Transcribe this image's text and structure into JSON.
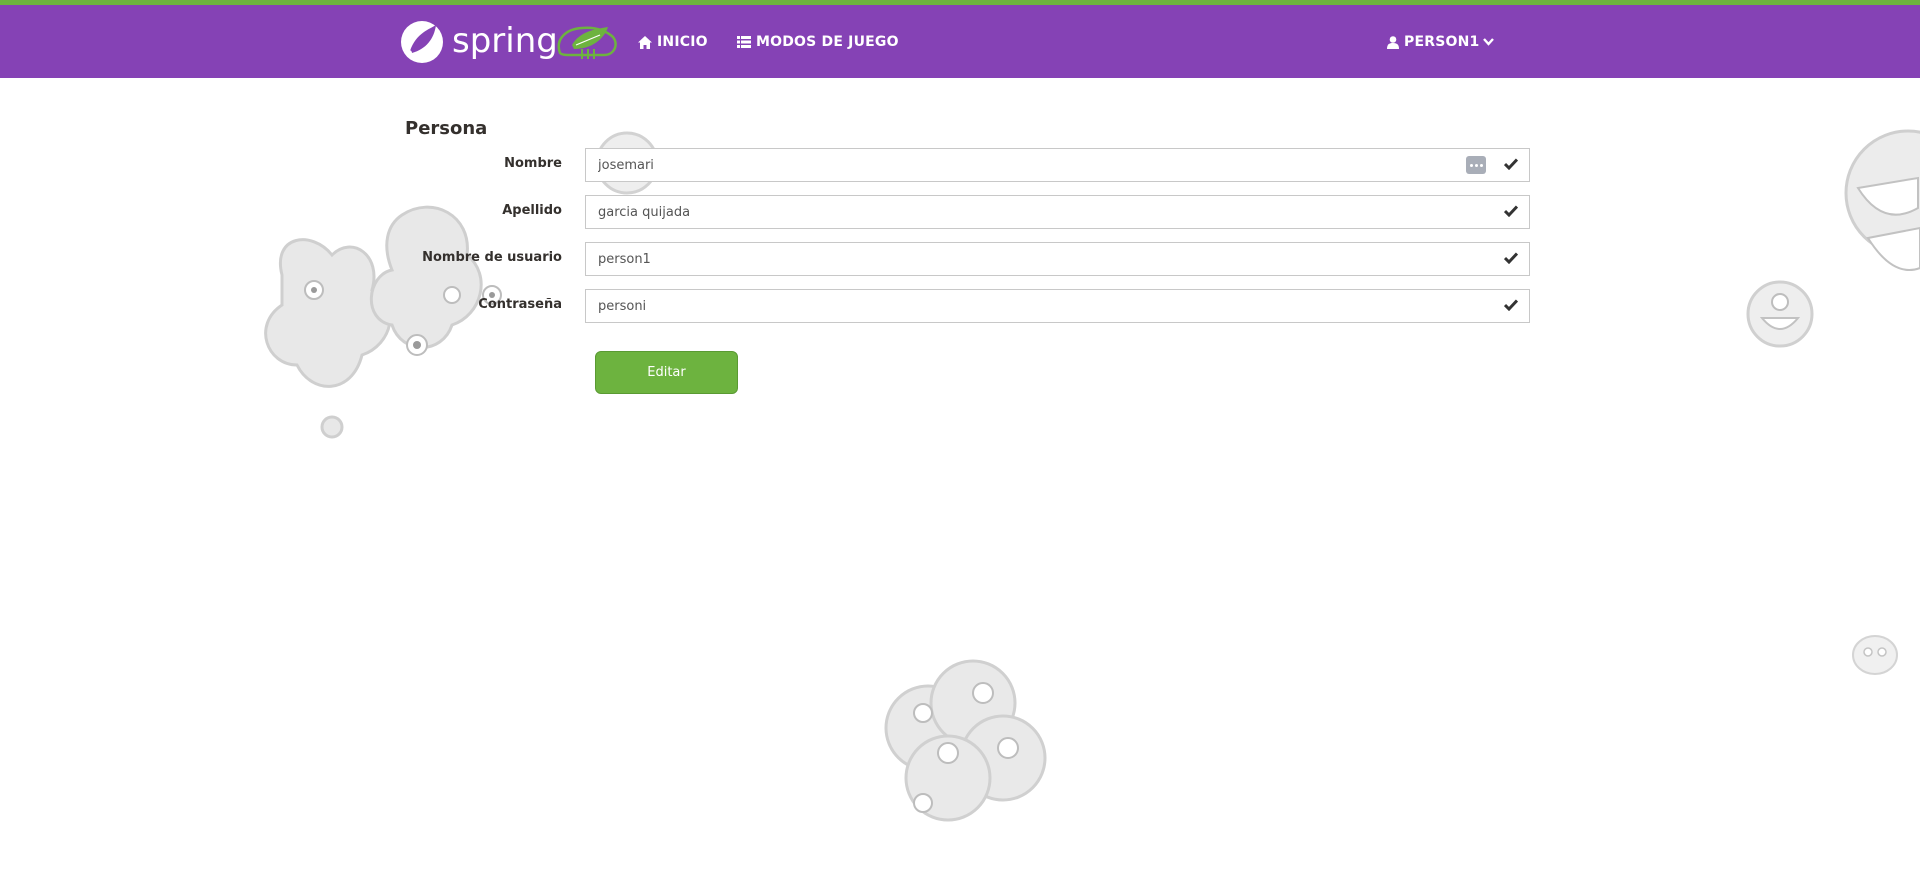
{
  "brand": {
    "logo_text": "spring"
  },
  "nav": {
    "inicio": "Inicio",
    "modos": "Modos de juego",
    "user": "person1"
  },
  "form": {
    "title": "Persona",
    "fields": [
      {
        "label": "Nombre",
        "value": "josemari"
      },
      {
        "label": "Apellido",
        "value": "garcia quijada"
      },
      {
        "label": "Nombre de usuario",
        "value": "person1"
      },
      {
        "label": "Contraseña",
        "value": "personi"
      }
    ],
    "submit": "Editar"
  },
  "colors": {
    "navbar": "#8542b5",
    "accent": "#6db33f"
  },
  "icons": [
    "home-icon",
    "list-icon",
    "user-icon",
    "chevron-down-icon",
    "check-icon",
    "more-icon"
  ]
}
